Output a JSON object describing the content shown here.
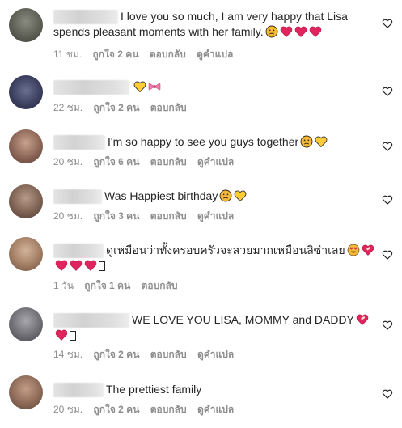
{
  "comments": [
    {
      "text": "I love you so much, I am very happy that Lisa spends pleasant moments with her family.",
      "emojis": [
        "sad-face",
        "red-heart",
        "red-heart",
        "red-heart"
      ],
      "time": "11 ชม.",
      "likes": "ถูกใจ 2 คน",
      "reply": "ตอบกลับ",
      "translate": "ดูคำแปล"
    },
    {
      "text": "",
      "emojis": [
        "yellow-heart",
        "ribbon"
      ],
      "time": "22 ชม.",
      "likes": "ถูกใจ 2 คน",
      "reply": "ตอบกลับ",
      "translate": ""
    },
    {
      "text": "I'm so happy to see you guys together",
      "emojis": [
        "sad-face",
        "yellow-heart"
      ],
      "time": "20 ชม.",
      "likes": "ถูกใจ 6 คน",
      "reply": "ตอบกลับ",
      "translate": "ดูคำแปล"
    },
    {
      "text": "Was Happiest birthday",
      "emojis": [
        "sad-face",
        "yellow-heart"
      ],
      "time": "20 ชม.",
      "likes": "ถูกใจ 3 คน",
      "reply": "ตอบกลับ",
      "translate": "ดูคำแปล"
    },
    {
      "text": "ดูเหมือนว่าทั้งครอบครัวจะสวยมากเหมือนลิซ่าเลย",
      "emojis": [
        "heart-eyes-face",
        "mending-heart",
        "red-heart",
        "red-heart",
        "red-heart",
        "box"
      ],
      "time": "1 วัน",
      "likes": "ถูกใจ 1 คน",
      "reply": "ตอบกลับ",
      "translate": ""
    },
    {
      "text": "WE LOVE YOU LISA, MOMMY and DADDY",
      "emojis": [
        "mending-heart",
        "red-heart",
        "box"
      ],
      "time": "14 ชม.",
      "likes": "ถูกใจ 2 คน",
      "reply": "ตอบกลับ",
      "translate": "ดูคำแปล"
    },
    {
      "text": "The prettiest family",
      "emojis": [],
      "time": "20 ชม.",
      "likes": "ถูกใจ 2 คน",
      "reply": "ตอบกลับ",
      "translate": "ดูคำแปล"
    }
  ],
  "colors": {
    "text": "#262626",
    "meta": "#8e8e8e",
    "red_heart": "#e0245e",
    "yellow_heart": "#ffcc33",
    "ribbon": "#f27aa9",
    "face": "#f5b93a"
  }
}
